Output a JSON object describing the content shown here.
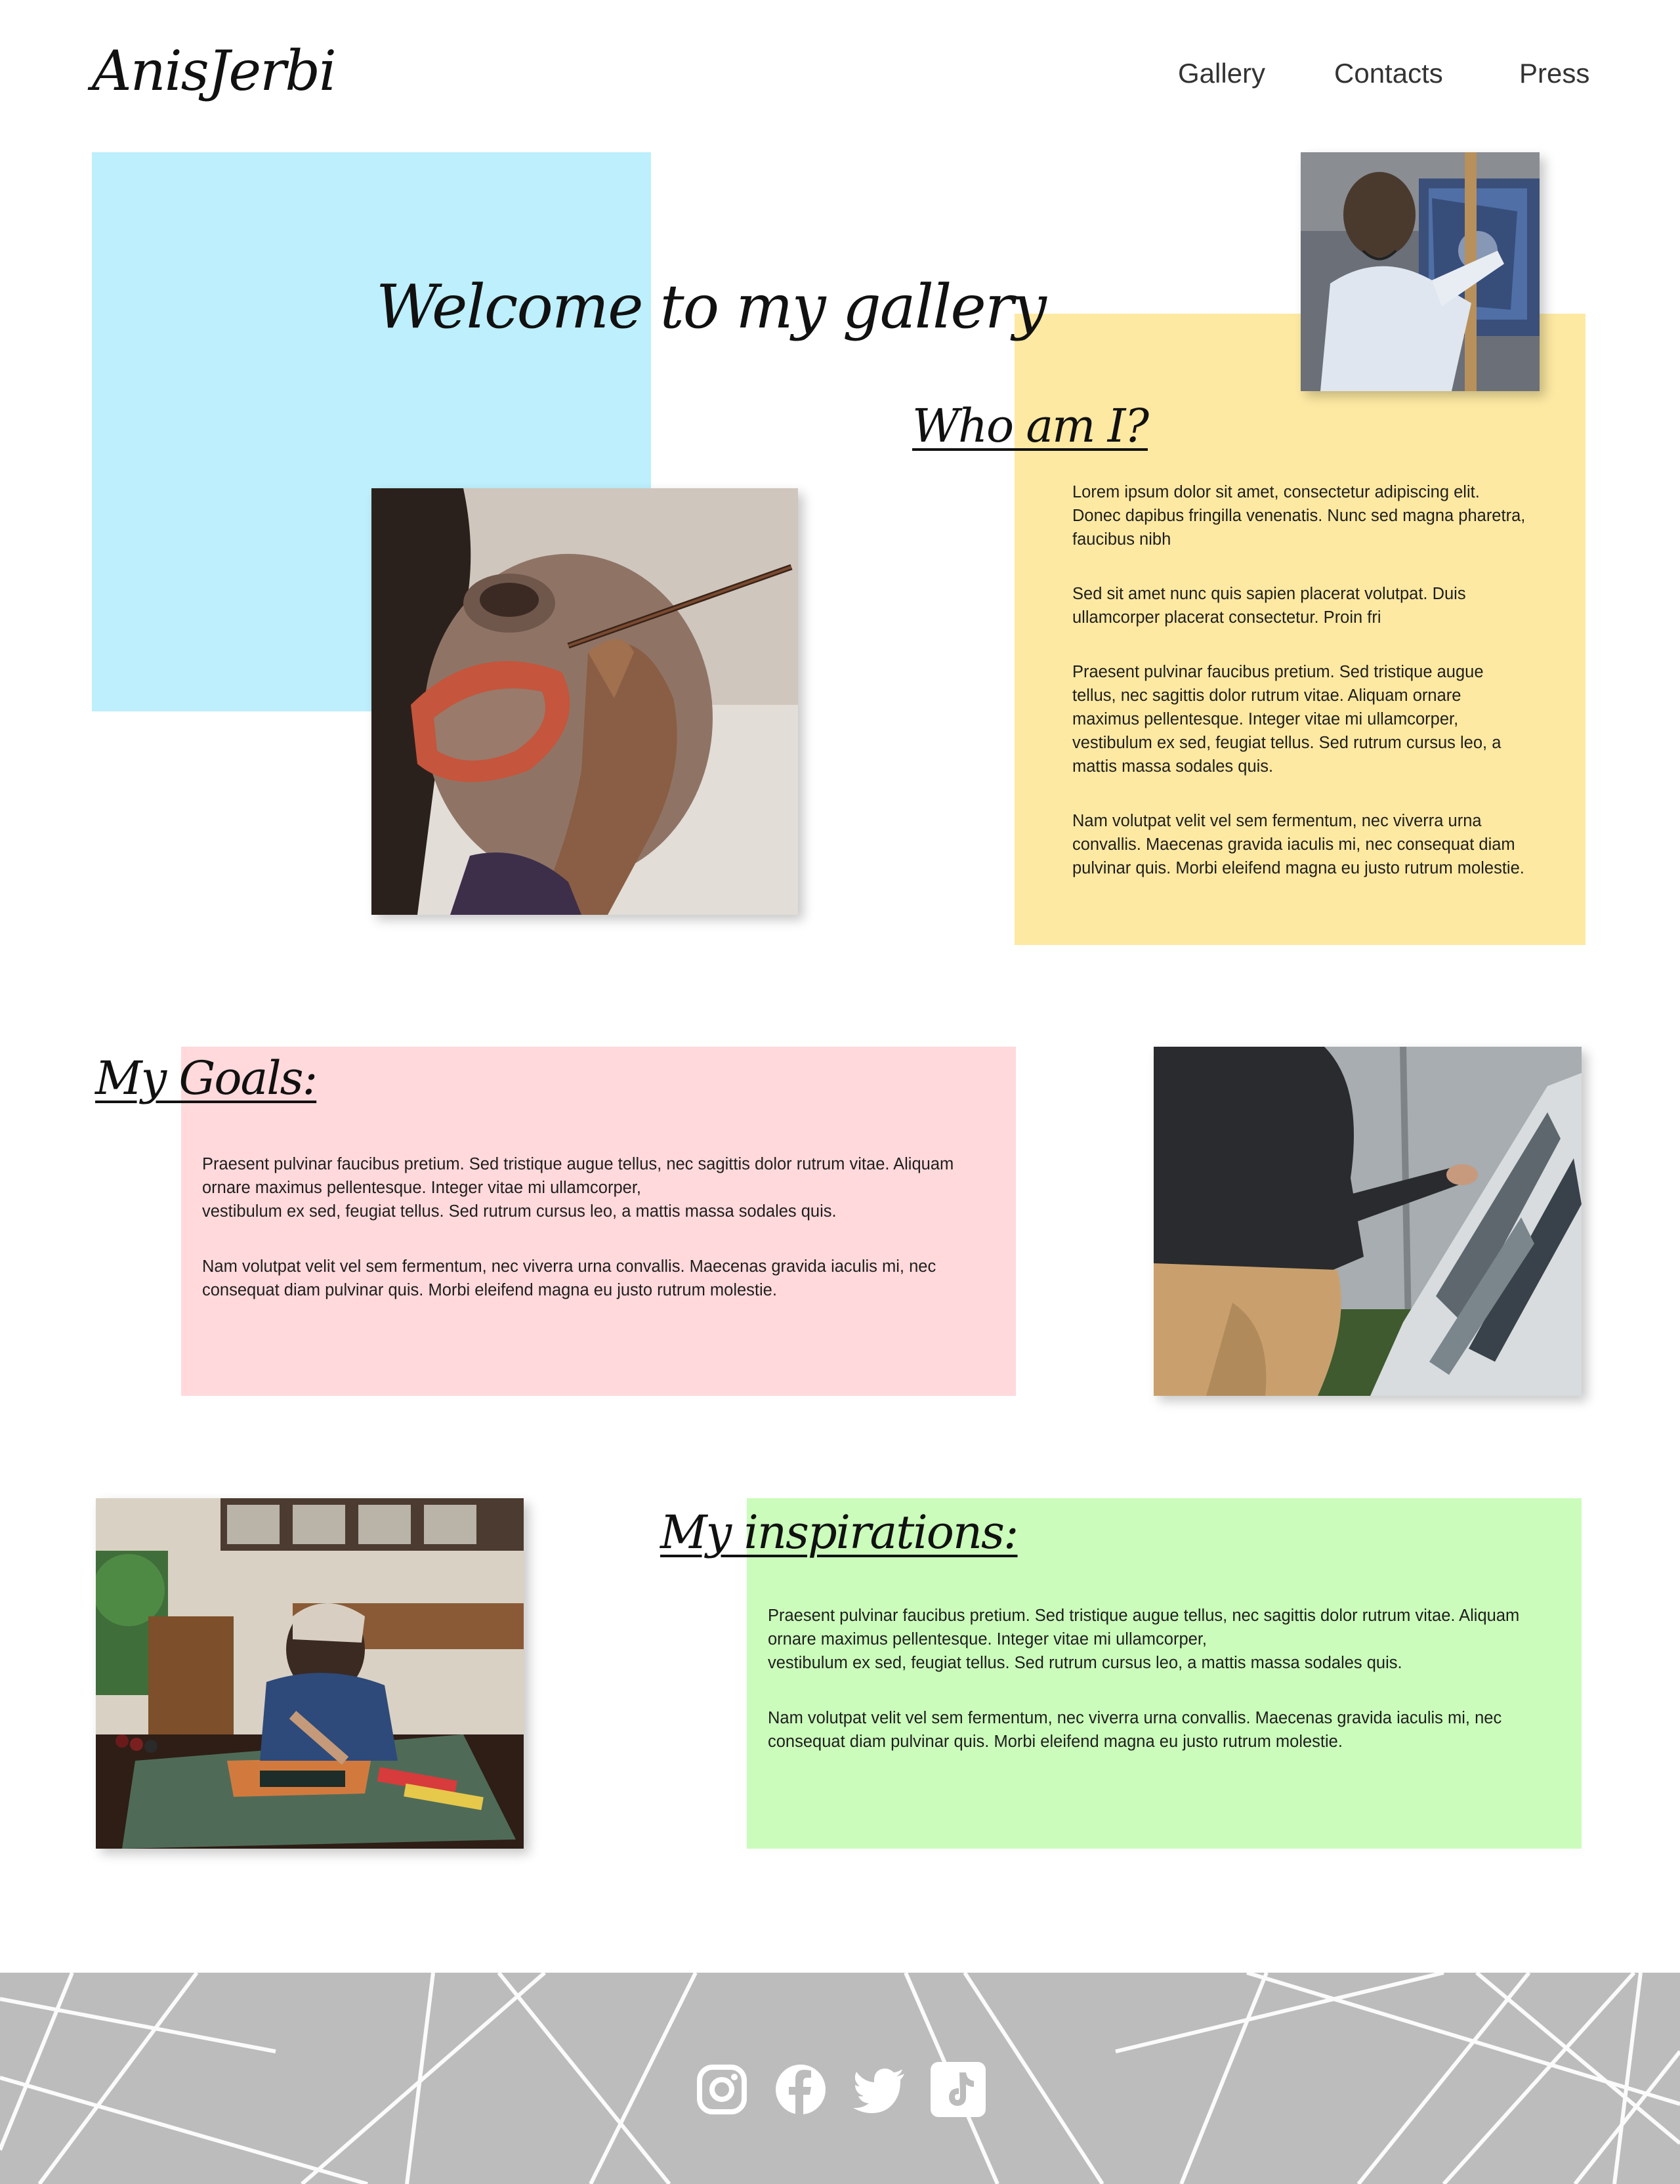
{
  "header": {
    "logo": "AnisJerbi",
    "nav": {
      "gallery": "Gallery",
      "contacts": "Contacts",
      "press": "Press"
    }
  },
  "hero": {
    "title": "Welcome to my gallery"
  },
  "who": {
    "title": "Who am I?",
    "paragraphs": [
      "Lorem ipsum dolor sit amet, consectetur adipiscing elit. Donec dapibus fringilla venenatis. Nunc sed magna pharetra, faucibus nibh",
      "Sed sit amet nunc quis sapien placerat volutpat. Duis ullamcorper placerat consectetur. Proin fri",
      "Praesent pulvinar faucibus pretium. Sed tristique augue tellus, nec sagittis dolor rutrum vitae. Aliquam ornare maximus pellentesque. Integer vitae mi ullamcorper, vestibulum ex sed, feugiat tellus. Sed rutrum cursus leo, a mattis massa sodales quis.",
      "Nam volutpat velit vel sem fermentum, nec viverra urna convallis. Maecenas gravida iaculis mi, nec consequat diam pulvinar quis. Morbi eleifend magna eu justo rutrum molestie."
    ]
  },
  "goals": {
    "title": "My Goals:",
    "paragraphs": [
      "Praesent pulvinar faucibus pretium. Sed tristique augue tellus, nec sagittis dolor rutrum vitae. Aliquam ornare maximus pellentesque. Integer vitae mi ullamcorper,\nvestibulum ex sed, feugiat tellus. Sed rutrum cursus leo, a mattis massa sodales quis.",
      "Nam volutpat velit vel sem fermentum, nec viverra urna convallis. Maecenas gravida iaculis mi, nec consequat diam pulvinar quis. Morbi eleifend magna eu justo rutrum molestie."
    ]
  },
  "inspirations": {
    "title": "My inspirations:",
    "paragraphs": [
      "Praesent pulvinar faucibus pretium. Sed tristique augue tellus, nec sagittis dolor rutrum vitae. Aliquam ornare maximus pellentesque. Integer vitae mi ullamcorper,\nvestibulum ex sed, feugiat tellus. Sed rutrum cursus leo, a mattis massa sodales quis.",
      "Nam volutpat velit vel sem fermentum, nec viverra urna convallis. Maecenas gravida iaculis mi, nec consequat diam pulvinar quis. Morbi eleifend magna eu justo rutrum molestie."
    ]
  },
  "footer": {
    "socials": [
      "instagram-icon",
      "facebook-icon",
      "twitter-icon",
      "tiktok-icon"
    ]
  },
  "colors": {
    "blue_block": "#bdeffc",
    "yellow_block": "#fde9a2",
    "pink_block": "#ffd9db",
    "green_block": "#cbfcbb",
    "footer_bg": "#bcbcbc"
  }
}
